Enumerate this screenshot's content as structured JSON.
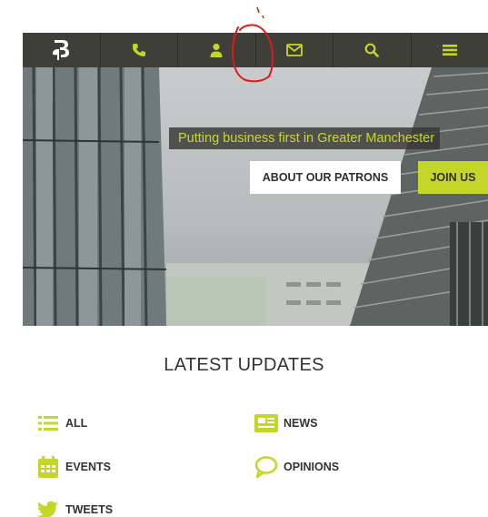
{
  "colors": {
    "accent": "#c5d62b",
    "nav_bg": "#3f3f3a",
    "text": "#333333",
    "annotation": "#e0181b"
  },
  "nav": {
    "items": [
      {
        "icon": "logo-icon"
      },
      {
        "icon": "phone-icon"
      },
      {
        "icon": "user-icon"
      },
      {
        "icon": "mail-icon"
      },
      {
        "icon": "search-icon"
      },
      {
        "icon": "menu-icon"
      }
    ]
  },
  "hero": {
    "tagline": "Putting business first in Greater Manchester",
    "patrons_button": "ABOUT OUR PATRONS",
    "join_button": "JOIN US"
  },
  "updates": {
    "title": "LATEST UPDATES",
    "filters": {
      "all": {
        "label": "ALL",
        "icon": "list-icon"
      },
      "news": {
        "label": "NEWS",
        "icon": "newspaper-icon"
      },
      "events": {
        "label": "EVENTS",
        "icon": "calendar-icon"
      },
      "opinions": {
        "label": "OPINIONS",
        "icon": "speech-bubble-icon"
      },
      "tweets": {
        "label": "TWEETS",
        "icon": "twitter-icon"
      }
    }
  }
}
